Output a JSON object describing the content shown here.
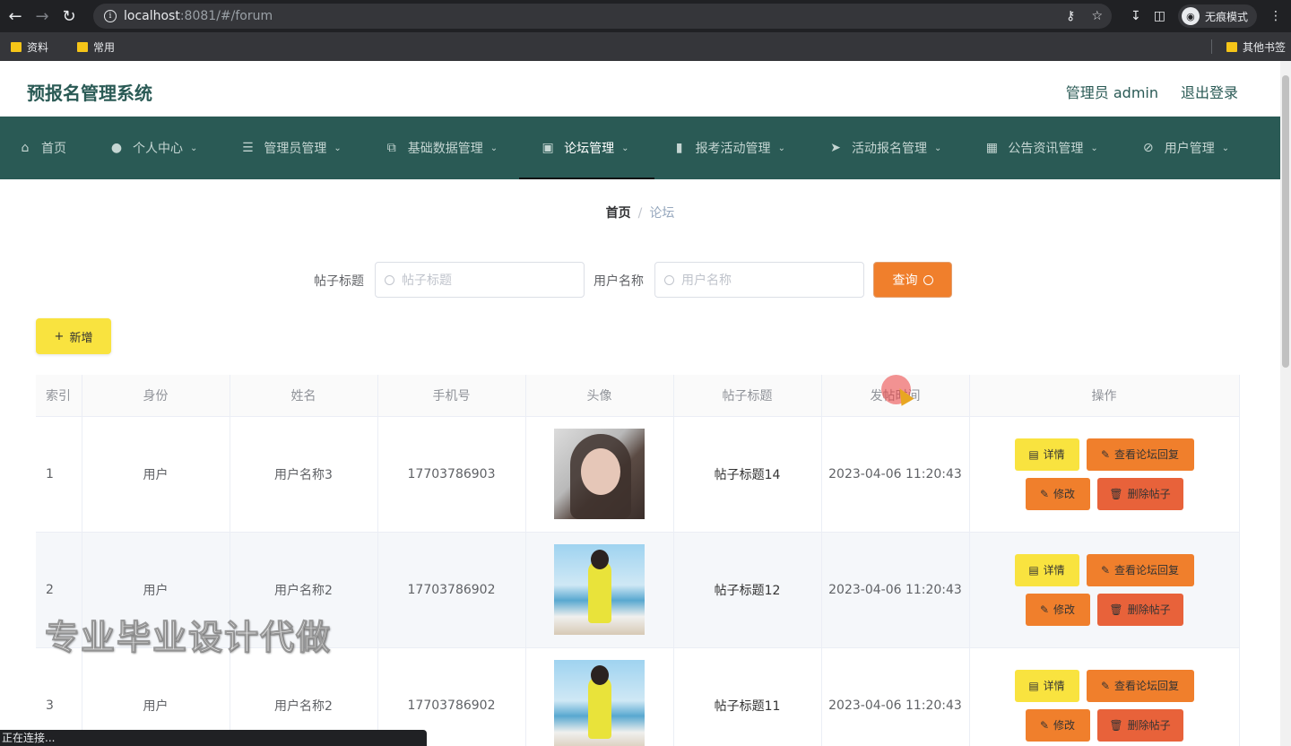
{
  "browser": {
    "url_host": "localhost",
    "url_path": ":8081/#/forum",
    "incognito_label": "无痕模式",
    "bookmarks": [
      "资料",
      "常用"
    ],
    "bookmarks_right": "其他书签",
    "status": "正在连接..."
  },
  "header": {
    "title": "预报名管理系统",
    "admin": "管理员 admin",
    "logout": "退出登录"
  },
  "nav": {
    "items": [
      {
        "label": "首页",
        "icon": "home-icon"
      },
      {
        "label": "个人中心",
        "icon": "user-icon"
      },
      {
        "label": "管理员管理",
        "icon": "list-icon"
      },
      {
        "label": "基础数据管理",
        "icon": "copy-icon"
      },
      {
        "label": "论坛管理",
        "icon": "book-icon"
      },
      {
        "label": "报考活动管理",
        "icon": "mic-icon"
      },
      {
        "label": "活动报名管理",
        "icon": "send-icon"
      },
      {
        "label": "公告资讯管理",
        "icon": "grid-icon"
      },
      {
        "label": "用户管理",
        "icon": "bell-off-icon"
      }
    ],
    "active": "论坛管理"
  },
  "breadcrumb": {
    "home": "首页",
    "sep": "/",
    "current": "论坛"
  },
  "search": {
    "title_label": "帖子标题",
    "title_placeholder": "帖子标题",
    "user_label": "用户名称",
    "user_placeholder": "用户名称",
    "button": "查询"
  },
  "add_button": "新增",
  "table": {
    "headers": [
      "索引",
      "身份",
      "姓名",
      "手机号",
      "头像",
      "帖子标题",
      "发帖时间",
      "操作"
    ],
    "rows": [
      {
        "index": "1",
        "role": "用户",
        "name": "用户名称3",
        "phone": "17703786903",
        "title": "帖子标题14",
        "time": "2023-04-06 11:20:43"
      },
      {
        "index": "2",
        "role": "用户",
        "name": "用户名称2",
        "phone": "17703786902",
        "title": "帖子标题12",
        "time": "2023-04-06 11:20:43"
      },
      {
        "index": "3",
        "role": "用户",
        "name": "用户名称2",
        "phone": "17703786902",
        "title": "帖子标题11",
        "time": "2023-04-06 11:20:43"
      }
    ],
    "ops": {
      "detail": "详情",
      "reply": "查看论坛回复",
      "edit": "修改",
      "delete": "删除帖子"
    }
  },
  "watermark": "专业毕业设计代做"
}
